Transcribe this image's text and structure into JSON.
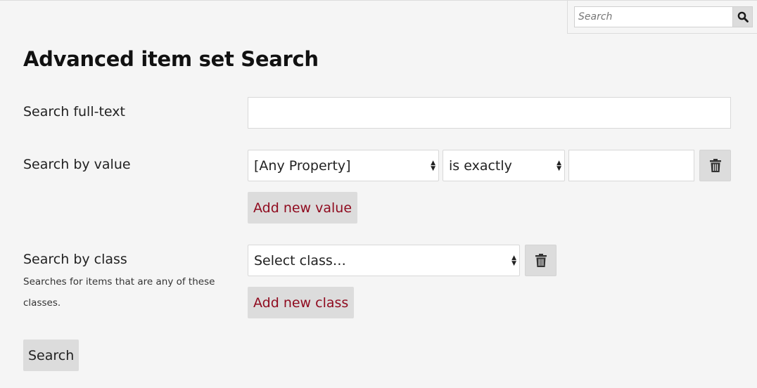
{
  "top_search": {
    "placeholder": "Search",
    "icon": "search-icon"
  },
  "page_title": "Advanced item set Search",
  "fulltext": {
    "label": "Search full-text",
    "value": ""
  },
  "value_search": {
    "label": "Search by value",
    "property_select": "[Any Property]",
    "operator_select": "is exactly",
    "value": "",
    "remove_icon": "trash-icon",
    "add_label": "Add new value"
  },
  "class_search": {
    "label": "Search by class",
    "hint": "Searches for items that are any of these classes.",
    "class_select": "Select class…",
    "remove_icon": "trash-icon",
    "add_label": "Add new class"
  },
  "submit_label": "Search",
  "colors": {
    "background": "#f5f5f5",
    "button_bg": "#dcdcdc",
    "accent_link": "#8f0a1e"
  }
}
